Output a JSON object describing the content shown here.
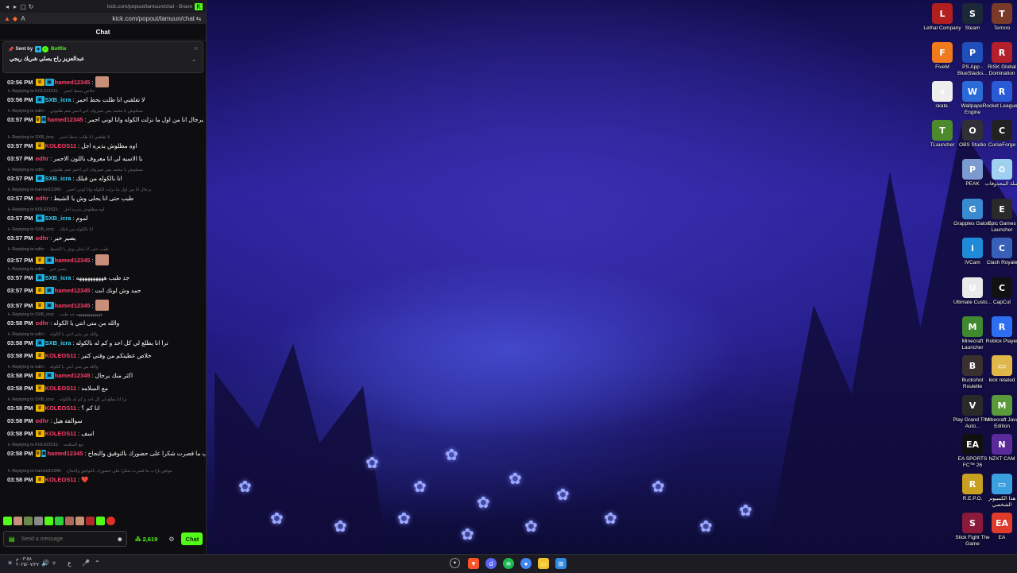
{
  "browser": {
    "title_url": "kick.com/popout/lamuun/chat - Brave",
    "address_url": "kick.com/popout/lamuun/chat"
  },
  "chat": {
    "header": "Chat",
    "pinned": {
      "sent_by_label": "Sent by",
      "sender": "BotRix",
      "message": "عبدالعزيز راح يصلي شريك ريجي"
    },
    "messages": [
      {
        "time": "03:56 PM",
        "user": "hamed12345",
        "color": "#ff3f6b",
        "badges": [
          "crown",
          "bot"
        ],
        "text": "",
        "emote": true
      },
      {
        "reply": "Replying to KOLEOS11:",
        "reply_text": "خلاص بسط احمر",
        "time": "03:56 PM",
        "user": "SXB_icra",
        "color": "#33d6ff",
        "badges": [
          "bot"
        ],
        "text": "لا تقلقني انا ظلت بحط احمر"
      },
      {
        "reply": "Replying to odhr:",
        "reply_text": "مسلوش يا محمد يس صيروف اني احمر ضم بقلبوني",
        "time": "03:57 PM",
        "user": "hamed12345",
        "color": "#ff3f6b",
        "badges": [
          "crown",
          "bot"
        ],
        "text": "يرجال انا من اول ما نزلت الكوله وانا لوني احمر"
      },
      {
        "reply": "Replying to SXB_icra:",
        "reply_text": "لا تقلقني انا ظلت بحط احمر",
        "time": "03:57 PM",
        "user": "KOLEOS11",
        "color": "#ff3f6b",
        "badges": [
          "crown"
        ],
        "text": "اوه مطلوش يذيره اجل"
      },
      {
        "time": "03:57 PM",
        "user": "odhr",
        "color": "#ff3f6b",
        "badges": [],
        "text": "يا الاسيه لي انا معروف باللون الاحمر"
      },
      {
        "reply": "Replying to odhr:",
        "reply_text": "مسلوش يا محمد يس صيروف اني احمر ضم بقلبوني",
        "time": "03:57 PM",
        "user": "SXB_icra",
        "color": "#33d6ff",
        "badges": [
          "bot"
        ],
        "text": "انا بالكوله من قبلك"
      },
      {
        "reply": "Replying to hamed12345:",
        "reply_text": "يرجال انا من اول ما نزلت الكوله وانا لوني احمر",
        "time": "03:57 PM",
        "user": "odhr",
        "color": "#ff3f6b",
        "badges": [],
        "text": "طيب حتى انا يحلى وش يا الشيط"
      },
      {
        "reply": "Replying to KOLEOS11:",
        "reply_text": "اوه مطلوش يذيره اجل",
        "time": "03:57 PM",
        "user": "SXB_icra",
        "color": "#33d6ff",
        "badges": [
          "bot"
        ],
        "text": "لموم"
      },
      {
        "reply": "Replying to SXB_icra:",
        "reply_text": "انا بالكوله من قبلك",
        "time": "03:57 PM",
        "user": "odhr",
        "color": "#ff3f6b",
        "badges": [],
        "text": "يصير خير"
      },
      {
        "reply": "Replying to odhr:",
        "reply_text": "طيب حتى انا يحلى وش يا الشيط",
        "time": "03:57 PM",
        "user": "hamed12345",
        "color": "#ff3f6b",
        "badges": [
          "crown",
          "bot"
        ],
        "text": "",
        "emote": true
      },
      {
        "reply": "Replying to odhr:",
        "reply_text": "يصير خير",
        "time": "03:57 PM",
        "user": "SXB_icra",
        "color": "#33d6ff",
        "badges": [
          "bot"
        ],
        "text": "جد طيب ههههههههههه"
      },
      {
        "time": "03:57 PM",
        "user": "hamed12345",
        "color": "#ff3f6b",
        "badges": [
          "crown",
          "bot"
        ],
        "text": "حمد وش لونك انت"
      },
      {
        "time": "03:57 PM",
        "user": "hamed12345",
        "color": "#ff3f6b",
        "badges": [
          "crown",
          "bot"
        ],
        "text": "",
        "emote": true
      },
      {
        "reply": "Replying to SXB_icra:",
        "reply_text": "ههههههههههههه جد طيب",
        "time": "03:58 PM",
        "user": "odhr",
        "color": "#ff3f6b",
        "badges": [],
        "text": "والله من متى انتي يا الكوله"
      },
      {
        "reply": "Replying to odhr:",
        "reply_text": "والله من متى انتي يا الكوله",
        "time": "03:58 PM",
        "user": "SXB_icra",
        "color": "#33d6ff",
        "badges": [
          "bot"
        ],
        "text": "ترا انا يطلع لي كل احد و كم له بالكوله"
      },
      {
        "time": "03:58 PM",
        "user": "KOLEOS11",
        "color": "#ff3f6b",
        "badges": [
          "crown"
        ],
        "text": "خلاص عطيتكم من وقتي كثير"
      },
      {
        "reply": "Replying to odhr:",
        "reply_text": "والله من متى انتي يا الكوله",
        "time": "03:58 PM",
        "user": "hamed12345",
        "color": "#ff3f6b",
        "badges": [
          "crown",
          "bot"
        ],
        "text": "اكثر منك يرجال"
      },
      {
        "time": "03:58 PM",
        "user": "KOLEOS11",
        "color": "#ff3f6b",
        "badges": [
          "crown"
        ],
        "text": "مع السلامه"
      },
      {
        "reply": "Replying to SXB_icra:",
        "reply_text": "ترا انا يطلع لي كل احد و كم له بالكوله",
        "time": "03:58 PM",
        "user": "KOLEOS11",
        "color": "#ff3f6b",
        "badges": [
          "crown"
        ],
        "text": "انا كم ؟"
      },
      {
        "time": "03:58 PM",
        "user": "odhr",
        "color": "#ff3f6b",
        "badges": [],
        "text": "سوالفة هيل"
      },
      {
        "time": "03:58 PM",
        "user": "KOLEOS11",
        "color": "#ff3f6b",
        "badges": [
          "crown"
        ],
        "text": "اسف"
      },
      {
        "reply": "Replying to KOLEOS11:",
        "reply_text": "مع السلامه",
        "time": "03:58 PM",
        "user": "hamed12345",
        "color": "#ff3f6b",
        "badges": [
          "crown",
          "bot"
        ],
        "text": "موفق ياراب ما قصرت شكرا على حضورك بالتوفيق والنجاح 🤍"
      },
      {
        "reply": "Replying to hamed12345:",
        "reply_text": "موفق ياراب ما قصرت شكرا على حضورك بالتوفيق والنجاح",
        "time": "03:58 PM",
        "user": "KOLEOS11",
        "color": "#ff3f6b",
        "badges": [
          "crown"
        ],
        "text": "❤️"
      }
    ],
    "input_placeholder": "Send a message",
    "viewer_count": "2,619",
    "send_label": "Chat"
  },
  "desktop_icons": [
    {
      "label": "Lethal Company",
      "color": "#b21f1f",
      "glyph": "L"
    },
    {
      "label": "Steam",
      "color": "#1b2838",
      "glyph": "S"
    },
    {
      "label": "Terroro",
      "color": "#7a3a2a",
      "glyph": "T"
    },
    {
      "label": "FiveM",
      "color": "#f07a1c",
      "glyph": "F"
    },
    {
      "label": "PS App - BlueStacks...",
      "color": "#1f4fb8",
      "glyph": "P"
    },
    {
      "label": "RISK Global Domination",
      "color": "#b31f2a",
      "glyph": "R"
    },
    {
      "label": "skate.",
      "color": "#eeeeee",
      "glyph": "s"
    },
    {
      "label": "Wallpaper Engine",
      "color": "#2b6bd8",
      "glyph": "W"
    },
    {
      "label": "Rocket League®",
      "color": "#2a5bd6",
      "glyph": "R"
    },
    {
      "label": "TLauncher",
      "color": "#4c8a2b",
      "glyph": "T"
    },
    {
      "label": "OBS Studio",
      "color": "#303036",
      "glyph": "O"
    },
    {
      "label": "CurseForge",
      "color": "#222222",
      "glyph": "C"
    },
    {
      "label": "PEAK",
      "color": "#7a9ad0",
      "glyph": "P"
    },
    {
      "label": "سلة المحذوفات",
      "color": "#9fd0f0",
      "glyph": "♻"
    },
    {
      "label": "Grapples Galore",
      "color": "#3a8ad0",
      "glyph": "G"
    },
    {
      "label": "Epic Games Launcher",
      "color": "#2a2a2a",
      "glyph": "E"
    },
    {
      "label": "iVCam",
      "color": "#1e8ad8",
      "glyph": "i"
    },
    {
      "label": "Clash Royale",
      "color": "#3860b8",
      "glyph": "C"
    },
    {
      "label": "Ultimate Custo...",
      "color": "#eaeaea",
      "glyph": "U"
    },
    {
      "label": "CapCut",
      "color": "#111111",
      "glyph": "C"
    },
    {
      "label": "Minecraft Launcher",
      "color": "#3f8a2e",
      "glyph": "M"
    },
    {
      "label": "Roblox Player",
      "color": "#2e6ef0",
      "glyph": "R"
    },
    {
      "label": "Buckshot Roulette",
      "color": "#3a3030",
      "glyph": "B"
    },
    {
      "label": "kick related",
      "color": "#e0b84a",
      "glyph": "▭"
    },
    {
      "label": "Play Grand Theft Auto...",
      "color": "#2a2a2a",
      "glyph": "V"
    },
    {
      "label": "Minecraft Java Edition",
      "color": "#5a9a3a",
      "glyph": "M"
    },
    {
      "label": "EA SPORTS FC™ 26",
      "color": "#101010",
      "glyph": "EA"
    },
    {
      "label": "NZXT CAM",
      "color": "#5a2a9a",
      "glyph": "N"
    },
    {
      "label": "R.E.P.O.",
      "color": "#c8a020",
      "glyph": "R"
    },
    {
      "label": "هذا الكمبيوتر الشخصي",
      "color": "#3aa0e0",
      "glyph": "▭"
    },
    {
      "label": "Stick Fight The Game",
      "color": "#8a1a3a",
      "glyph": "S"
    },
    {
      "label": "EA",
      "color": "#e03a2a",
      "glyph": "EA"
    }
  ],
  "taskbar": {
    "tray_date": "٢٠٢٥/٠٧/٢٧",
    "tray_time": "٠٣:٥٨ م",
    "language": "ع"
  }
}
